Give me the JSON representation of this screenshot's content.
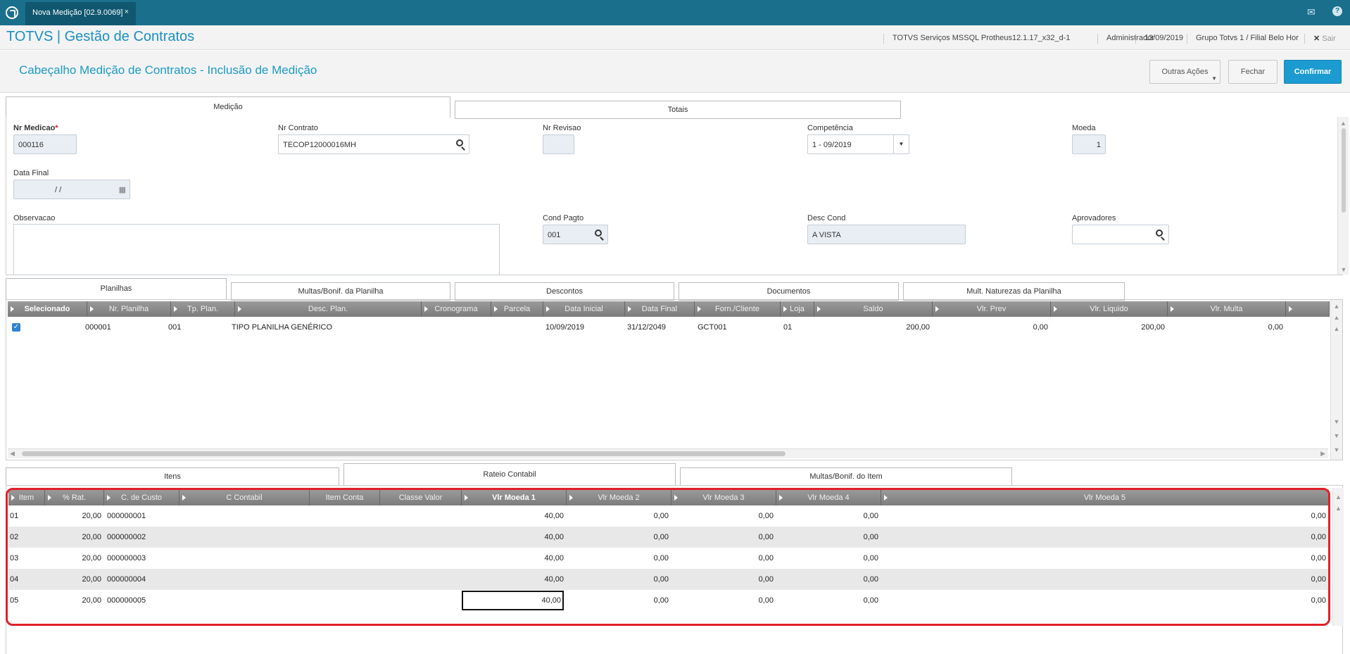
{
  "topbar": {
    "tab_label": "Nova Medição [02.9.0069]",
    "close": "×",
    "mail_icon": "mail-icon",
    "help_icon": "help-icon"
  },
  "header": {
    "brand": "TOTVS | Gestão de Contratos",
    "environment": "TOTVS Serviços MSSQL Protheus12.1.17_x32_d-1",
    "user": "Administrador",
    "date": "13/09/2019",
    "branch": "Grupo Totvs 1 / Filial Belo Hor",
    "exit": "Sair"
  },
  "page": {
    "title": "Cabeçalho Medição de Contratos - Inclusão de Medição",
    "buttons": {
      "more": "Outras Ações",
      "close": "Fechar",
      "confirm": "Confirmar"
    }
  },
  "top_tabs": [
    "Medição",
    "Totais"
  ],
  "form": {
    "nr_medicao": {
      "label": "Nr Medicao",
      "required": "*",
      "value": "000116"
    },
    "nr_contrato": {
      "label": "Nr Contrato",
      "value": "TECOP12000016MH"
    },
    "nr_revisao": {
      "label": "Nr Revisao",
      "value": ""
    },
    "competencia": {
      "label": "Competência",
      "value": "1 - 09/2019"
    },
    "moeda": {
      "label": "Moeda",
      "value": "1"
    },
    "data_final": {
      "label": "Data Final",
      "value": "/  /"
    },
    "observacao": {
      "label": "Observacao",
      "value": ""
    },
    "cond_pagto": {
      "label": "Cond Pagto",
      "value": "001"
    },
    "desc_cond": {
      "label": "Desc Cond",
      "value": "A VISTA"
    },
    "aprovadores": {
      "label": "Aprovadores",
      "value": ""
    }
  },
  "mid_tabs": [
    "Planilhas",
    "Multas/Bonif. da Planilha",
    "Descontos",
    "Documentos",
    "Mult. Naturezas da Planilha"
  ],
  "planilhas": {
    "columns": [
      "Selecionado",
      "Nr. Planilha",
      "Tp. Plan.",
      "Desc. Plan.",
      "Cronograma",
      "Parcela",
      "Data Inicial",
      "Data Final",
      "Forn./Cliente",
      "Loja",
      "Saldo",
      "Vlr. Prev",
      "Vlr. Liquido",
      "Vlr. Multa"
    ],
    "rows": [
      {
        "checked": "✓",
        "nr": "000001",
        "tp": "001",
        "desc": "TIPO PLANILHA GENÉRICO",
        "crono": "",
        "parcela": "",
        "ini": "10/09/2019",
        "fim": "31/12/2049",
        "forn": "GCT001",
        "loja": "01",
        "saldo": "200,00",
        "prev": "0,00",
        "liq": "200,00",
        "multa": "0,00"
      }
    ]
  },
  "bottom_tabs": [
    "Itens",
    "Rateio Contabil",
    "Multas/Bonif. do Item"
  ],
  "rateio": {
    "columns": [
      "Item",
      "% Rat.",
      "C. de Custo",
      "C Contabil",
      "Item Conta",
      "Classe Valor",
      "Vlr Moeda 1",
      "Vlr Moeda 2",
      "Vlr Moeda 3",
      "Vlr Moeda 4",
      "Vlr Moeda 5"
    ],
    "rows": [
      {
        "item": "01",
        "rat": "20,00",
        "cc": "000000001",
        "m1": "40,00",
        "m2": "0,00",
        "m3": "0,00",
        "m4": "0,00",
        "m5": "0,00"
      },
      {
        "item": "02",
        "rat": "20,00",
        "cc": "000000002",
        "m1": "40,00",
        "m2": "0,00",
        "m3": "0,00",
        "m4": "0,00",
        "m5": "0,00"
      },
      {
        "item": "03",
        "rat": "20,00",
        "cc": "000000003",
        "m1": "40,00",
        "m2": "0,00",
        "m3": "0,00",
        "m4": "0,00",
        "m5": "0,00"
      },
      {
        "item": "04",
        "rat": "20,00",
        "cc": "000000004",
        "m1": "40,00",
        "m2": "0,00",
        "m3": "0,00",
        "m4": "0,00",
        "m5": "0,00"
      },
      {
        "item": "05",
        "rat": "20,00",
        "cc": "000000005",
        "m1": "40,00",
        "m2": "0,00",
        "m3": "0,00",
        "m4": "0,00",
        "m5": "0,00"
      }
    ]
  },
  "colors": {
    "accent": "#1b9bd0",
    "topbar": "#1a6f8c",
    "highlight": "#e0202a"
  }
}
